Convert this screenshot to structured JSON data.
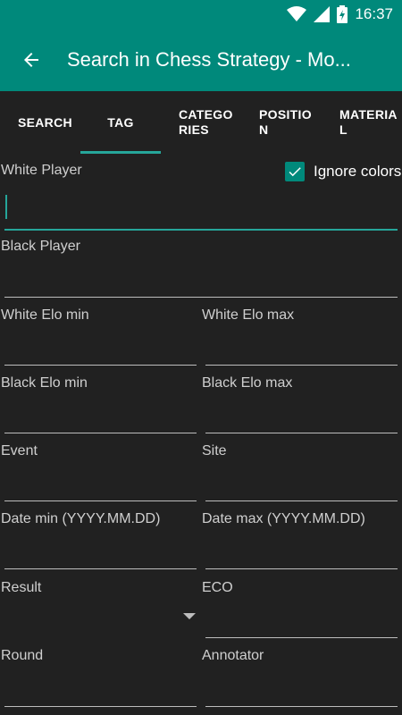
{
  "status_bar": {
    "time": "16:37",
    "icons": [
      "wifi-icon",
      "signal-icon",
      "battery-charging-icon"
    ]
  },
  "toolbar": {
    "back_icon": "arrow-back-icon",
    "title": "Search in Chess Strategy - Mo..."
  },
  "tabs": [
    {
      "label": "SEARCH",
      "active": false
    },
    {
      "label": "TAG",
      "active": true
    },
    {
      "label": "CATEGORIES",
      "active": false
    },
    {
      "label": "POSITION",
      "active": false
    },
    {
      "label": "MATERIAL",
      "active": false
    }
  ],
  "form": {
    "white_player": {
      "label": "White Player",
      "value": ""
    },
    "ignore_colors": {
      "label": "Ignore colors",
      "checked": true
    },
    "black_player": {
      "label": "Black Player",
      "value": ""
    },
    "white_elo_min": {
      "label": "White Elo min",
      "value": ""
    },
    "white_elo_max": {
      "label": "White Elo max",
      "value": ""
    },
    "black_elo_min": {
      "label": "Black Elo min",
      "value": ""
    },
    "black_elo_max": {
      "label": "Black Elo max",
      "value": ""
    },
    "event": {
      "label": "Event",
      "value": ""
    },
    "site": {
      "label": "Site",
      "value": ""
    },
    "date_min": {
      "label": "Date min (YYYY.MM.DD)",
      "value": ""
    },
    "date_max": {
      "label": "Date max (YYYY.MM.DD)",
      "value": ""
    },
    "result": {
      "label": "Result",
      "value": ""
    },
    "eco": {
      "label": "ECO",
      "value": ""
    },
    "round": {
      "label": "Round",
      "value": ""
    },
    "annotator": {
      "label": "Annotator",
      "value": ""
    }
  },
  "colors": {
    "accent": "#00897b",
    "accent_light": "#26a69a",
    "background": "#212121"
  }
}
